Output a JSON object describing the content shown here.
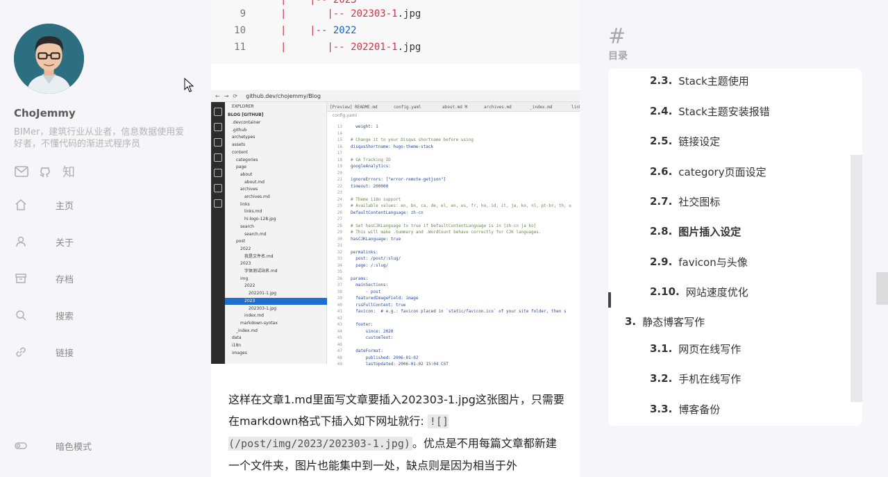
{
  "profile": {
    "name": "ChoJemmy",
    "description": "BIMer，建筑行业从业者，信息数据使用爱好者，不懂代码的渐进式程序员"
  },
  "social": [
    {
      "icon": "mail-icon"
    },
    {
      "icon": "github-icon"
    },
    {
      "icon": "zhihu-icon",
      "glyph": "知"
    }
  ],
  "menu": [
    {
      "icon": "home-icon",
      "label": "主页"
    },
    {
      "icon": "user-icon",
      "label": "关于"
    },
    {
      "icon": "archive-icon",
      "label": "存档"
    },
    {
      "icon": "search-icon",
      "label": "搜索"
    },
    {
      "icon": "link-icon",
      "label": "链接"
    }
  ],
  "dark_mode": {
    "icon": "toggle-icon",
    "label": "暗色模式"
  },
  "code_block": {
    "lines": [
      {
        "num": "9",
        "tree": "|       |-- ",
        "name": "202303-1",
        "ext": ".jpg"
      },
      {
        "num": "10",
        "tree": "|    |-- ",
        "name": "",
        "ext": "2022"
      },
      {
        "num": "11",
        "tree": "|       |-- ",
        "name": "202201-1",
        "ext": ".jpg"
      }
    ],
    "top_fragment": "2023"
  },
  "screenshot": {
    "url": "github.dev/chojemmy/Blog",
    "explorer_title": "EXPLORER",
    "repo": "BLOG [GITHUB]",
    "tree": [
      ".devcontainer",
      ".github",
      "archetypes",
      "assets",
      "content",
      "categories",
      "page",
      "about",
      "about.md",
      "archives",
      "archives.md",
      "links",
      "links.md",
      "hi-logo-128.jpg",
      "search",
      "search.md",
      "post",
      "2022",
      "我是文件名.md",
      "2023",
      "字体测试站名.md",
      "img",
      "2022",
      "202201-1.jpg",
      "2023",
      "202303-1.jpg",
      "index.md",
      "markdown-syntax",
      "_index.md",
      "data",
      "i18n",
      "images"
    ],
    "tabs": [
      "[Preview] README.md",
      "config.yaml",
      "about.md M",
      "archives.md",
      "_index.md",
      "link"
    ],
    "editor_file": "config.yaml",
    "editor_lines": [
      {
        "n": "13",
        "t": "  weight: 1"
      },
      {
        "n": "14",
        "t": ""
      },
      {
        "n": "15",
        "t": "# Change it to your Disqus shortname before using",
        "cm": true
      },
      {
        "n": "16",
        "t": "disqusShortname: hugo-theme-stack"
      },
      {
        "n": "17",
        "t": ""
      },
      {
        "n": "18",
        "t": "# GA Tracking ID",
        "cm": true
      },
      {
        "n": "19",
        "t": "googleAnalytics:"
      },
      {
        "n": "20",
        "t": ""
      },
      {
        "n": "21",
        "t": "ignoreErrors: [\"error-remote-getjson\"]"
      },
      {
        "n": "22",
        "t": "timeout: 200000"
      },
      {
        "n": "23",
        "t": ""
      },
      {
        "n": "24",
        "t": "# Theme i18n support",
        "cm": true
      },
      {
        "n": "25",
        "t": "# Available values: en, bn, ca, de, el, en, es, fr, hu, id, it, ja, ko, nl, pt-br, th, u",
        "cm": true
      },
      {
        "n": "26",
        "t": "DefaultContentLanguage: zh-cn"
      },
      {
        "n": "27",
        "t": ""
      },
      {
        "n": "28",
        "t": "# Set hasCJKLanguage to true if DefaultContentLanguage is in [zh-cn ja ko]",
        "cm": true
      },
      {
        "n": "29",
        "t": "# This will make .Summary and .WordCount behave correctly for CJK languages.",
        "cm": true
      },
      {
        "n": "30",
        "t": "hasCJKLanguage: true"
      },
      {
        "n": "31",
        "t": ""
      },
      {
        "n": "32",
        "t": "permalinks:"
      },
      {
        "n": "33",
        "t": "  post: /post/:slug/"
      },
      {
        "n": "34",
        "t": "  page: /:slug/"
      },
      {
        "n": "35",
        "t": ""
      },
      {
        "n": "36",
        "t": "params:"
      },
      {
        "n": "37",
        "t": "  mainSections:"
      },
      {
        "n": "38",
        "t": "      - post"
      },
      {
        "n": "39",
        "t": "  featuredImageField: image"
      },
      {
        "n": "40",
        "t": "  rssFullContent: true"
      },
      {
        "n": "41",
        "t": "  favicon:  # e.g.: favicon placed in `static/favicon.ico` of your site folder, then s"
      },
      {
        "n": "42",
        "t": ""
      },
      {
        "n": "43",
        "t": "  footer:"
      },
      {
        "n": "44",
        "t": "      since: 2020"
      },
      {
        "n": "45",
        "t": "      customText:"
      },
      {
        "n": "46",
        "t": ""
      },
      {
        "n": "47",
        "t": "  dateFormat:"
      },
      {
        "n": "48",
        "t": "      published: 2006-01-02"
      },
      {
        "n": "49",
        "t": "      lastUpdated: 2006-01-02 15:04 CST"
      }
    ]
  },
  "paragraph": {
    "part1": "这样在文章1.md里面写文章要插入202303-1.jpg这张图片，只需要在markdown格式下插入如下网址就行: ",
    "code1": "![](/post/img/2023/202303-1.jpg)",
    "part2": "。优点是不用每篇文章都新建一个文件夹，图片也能集中到一处，缺点则是因为相当于外"
  },
  "toc": {
    "hash": "#",
    "title": "目录",
    "items": [
      {
        "num": "2.3.",
        "text": "Stack主题使用"
      },
      {
        "num": "2.4.",
        "text": "Stack主题安装报错"
      },
      {
        "num": "2.5.",
        "text": "链接设定"
      },
      {
        "num": "2.6.",
        "text": "category页面设定"
      },
      {
        "num": "2.7.",
        "text": "社交图标"
      },
      {
        "num": "2.8.",
        "text": "图片插入设定",
        "active": true
      },
      {
        "num": "2.9.",
        "text": "favicon与头像"
      },
      {
        "num": "2.10.",
        "text": "网站速度优化"
      },
      {
        "num": "3.",
        "text": "静态博客写作"
      },
      {
        "num": "3.1.",
        "text": "网页在线写作"
      },
      {
        "num": "3.2.",
        "text": "手机在线写作"
      },
      {
        "num": "3.3.",
        "text": "博客备份"
      }
    ]
  }
}
